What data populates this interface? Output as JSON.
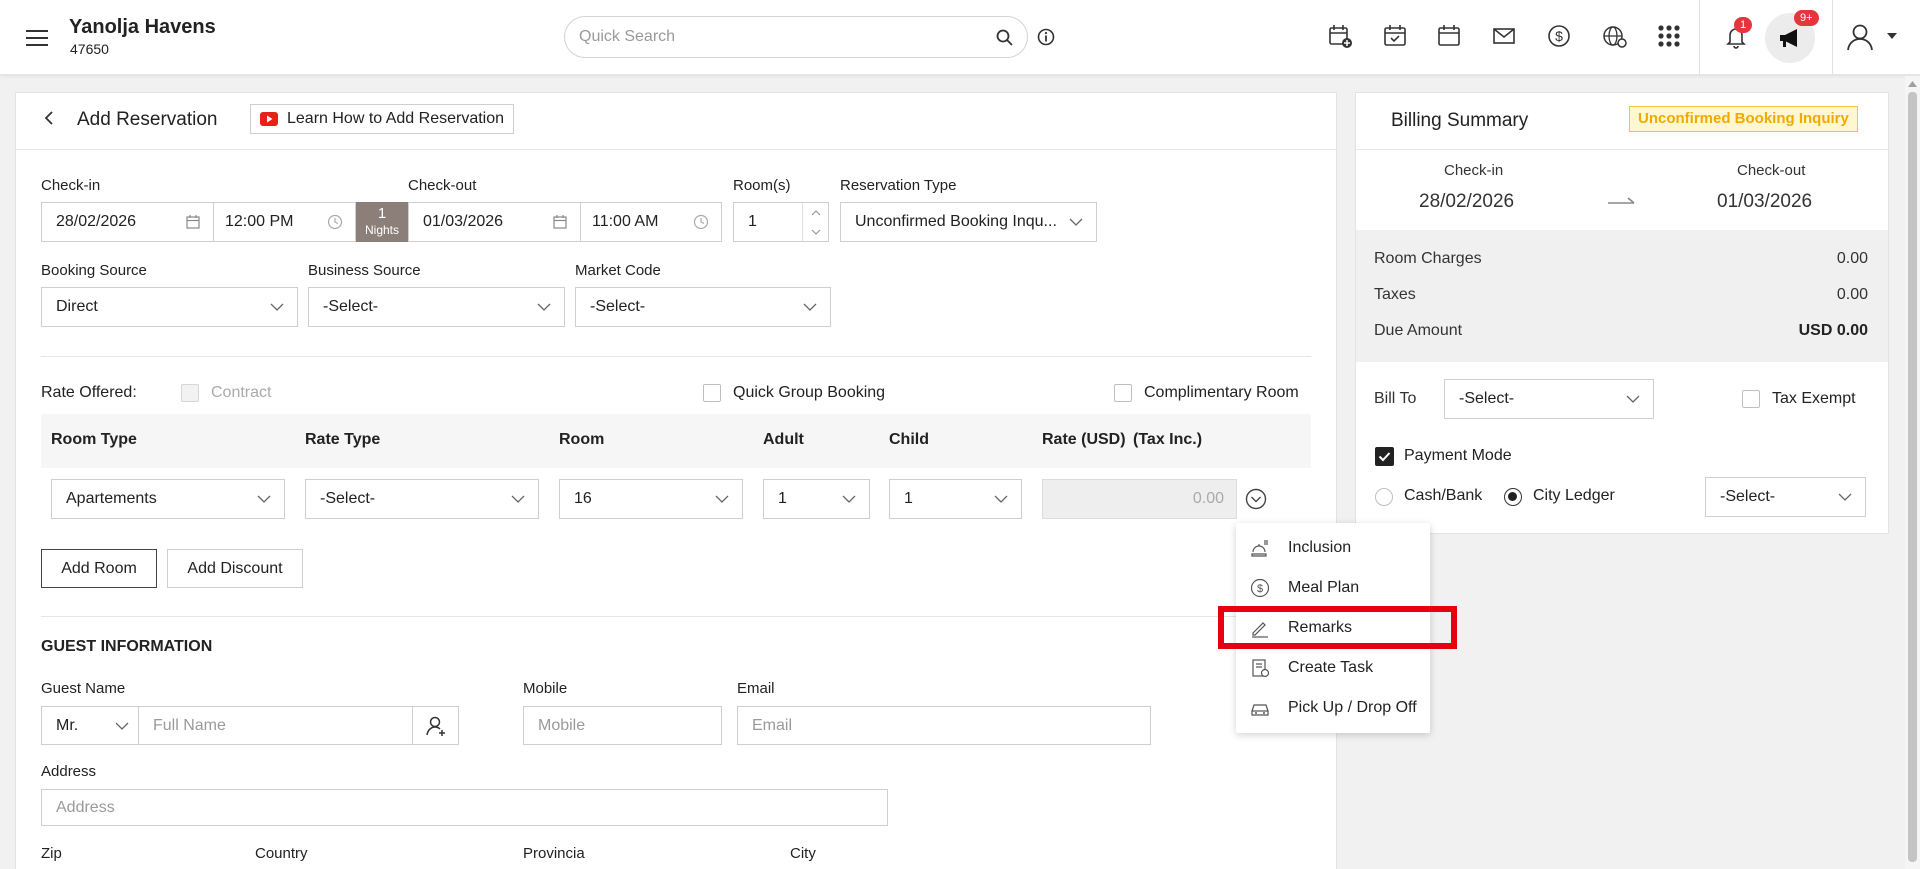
{
  "header": {
    "hotel_name": "Yanolja Havens",
    "hotel_id": "47650",
    "search_placeholder": "Quick Search",
    "notification_count": "1",
    "announcement_count": "9+"
  },
  "reservation": {
    "title": "Add Reservation",
    "learn_link": "Learn How to Add Reservation",
    "checkin_label": "Check-in",
    "checkin_date": "28/02/2026",
    "checkin_time": "12:00 PM",
    "nights_count": "1",
    "nights_label": "Nights",
    "checkout_label": "Check-out",
    "checkout_date": "01/03/2026",
    "checkout_time": "11:00 AM",
    "rooms_label": "Room(s)",
    "rooms_value": "1",
    "reservation_type_label": "Reservation Type",
    "reservation_type_value": "Unconfirmed Booking Inqu...",
    "booking_source_label": "Booking Source",
    "booking_source_value": "Direct",
    "business_source_label": "Business Source",
    "business_source_value": "-Select-",
    "market_code_label": "Market Code",
    "market_code_value": "-Select-",
    "rate_offered_label": "Rate Offered:",
    "contract_label": "Contract",
    "quick_group_label": "Quick Group Booking",
    "complimentary_label": "Complimentary Room",
    "table_headers": {
      "room_type": "Room Type",
      "rate_type": "Rate Type",
      "room": "Room",
      "adult": "Adult",
      "child": "Child",
      "rate": "Rate (USD)",
      "tax": "(Tax Inc.)"
    },
    "row": {
      "room_type": "Apartements",
      "rate_type": "-Select-",
      "room": "16",
      "adult": "1",
      "child": "1",
      "rate": "0.00"
    },
    "add_room_label": "Add Room",
    "add_discount_label": "Add Discount"
  },
  "guest": {
    "section_title": "GUEST INFORMATION",
    "guest_name_label": "Guest Name",
    "salutation": "Mr.",
    "full_name_placeholder": "Full Name",
    "mobile_label": "Mobile",
    "mobile_placeholder": "Mobile",
    "email_label": "Email",
    "email_placeholder": "Email",
    "address_label": "Address",
    "address_placeholder": "Address",
    "zip_label": "Zip",
    "country_label": "Country",
    "provincia_label": "Provincia",
    "city_label": "City"
  },
  "menu": {
    "items": [
      {
        "label": "Inclusion",
        "icon": "inclusion-icon"
      },
      {
        "label": "Meal Plan",
        "icon": "dollar-circle-icon"
      },
      {
        "label": "Remarks",
        "icon": "pencil-icon"
      },
      {
        "label": "Create Task",
        "icon": "task-icon"
      },
      {
        "label": "Pick Up / Drop Off",
        "icon": "car-icon"
      }
    ],
    "highlighted": "Remarks"
  },
  "billing": {
    "title": "Billing Summary",
    "status_badge": "Unconfirmed Booking Inquiry",
    "checkin_label": "Check-in",
    "checkin_date": "28/02/2026",
    "checkout_label": "Check-out",
    "checkout_date": "01/03/2026",
    "room_charges_label": "Room Charges",
    "room_charges_value": "0.00",
    "taxes_label": "Taxes",
    "taxes_value": "0.00",
    "due_label": "Due Amount",
    "due_value": "USD 0.00",
    "bill_to_label": "Bill To",
    "bill_to_value": "-Select-",
    "tax_exempt_label": "Tax Exempt",
    "payment_mode_label": "Payment Mode",
    "cash_bank_label": "Cash/Bank",
    "city_ledger_label": "City Ledger",
    "payment_select_value": "-Select-"
  },
  "colors": {
    "accent": "#1a1a1a",
    "badge_red": "#e5363b",
    "highlight_red": "#e8000b",
    "warn_text": "#f2a900",
    "warn_bg": "#fff7d1",
    "nights_bg": "#8c7f7a",
    "youtube_red": "#e62117"
  }
}
